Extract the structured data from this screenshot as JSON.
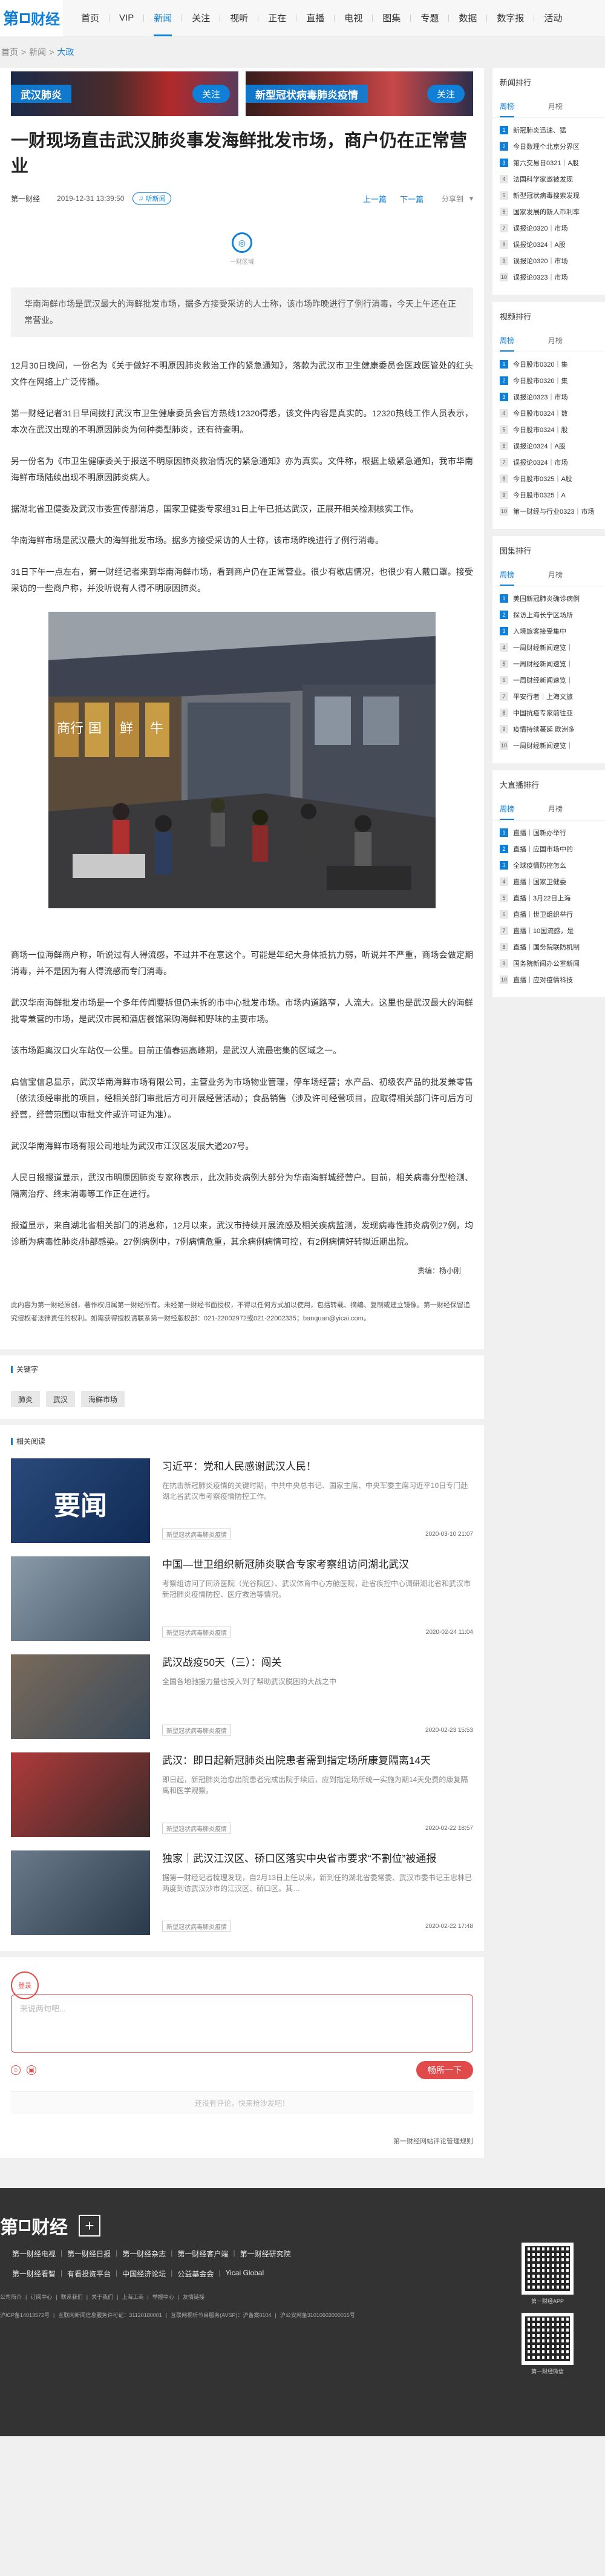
{
  "nav": {
    "logo_num": "第",
    "logo_txt": "财经",
    "links": [
      "首页",
      "VIP",
      "新闻",
      "关注",
      "视听",
      "正在",
      "直播",
      "电视",
      "图集",
      "专题",
      "数据",
      "数字报",
      "活动"
    ],
    "active_index": 2
  },
  "breadcrumb": {
    "home": "首页",
    "news": "新闻",
    "current": "大政",
    "sep": ">"
  },
  "topics": [
    {
      "name": "武汉肺炎",
      "follow": "关注"
    },
    {
      "name": "新型冠状病毒肺炎疫情",
      "follow": "关注"
    }
  ],
  "article": {
    "title": "一财现场直击武汉肺炎事发海鲜批发市场，商户仍在正常营业",
    "source": "第一财经",
    "date": "2019-12-31 13:39:50",
    "badge": "听新闻",
    "prev": "上一篇",
    "next": "下一篇",
    "share": "分享到",
    "author_logo": "一财",
    "author_name": "一财区域",
    "summary": "华南海鲜市场是武汉最大的海鲜批发市场，据多方接受采访的人士称，该市场昨晚进行了例行消毒，今天上午还在正常营业。",
    "paragraphs": [
      "12月30日晚间，一份名为《关于做好不明原因肺炎救治工作的紧急通知》，落款为武汉市卫生健康委员会医政医管处的红头文件在网络上广泛传播。",
      "第一财经记者31日早间拨打武汉市卫生健康委员会官方热线12320得悉，该文件内容是真实的。12320热线工作人员表示，本次在武汉出现的不明原因肺炎为何种类型肺炎，还有待查明。",
      "另一份名为《市卫生健康委关于报送不明原因肺炎救治情况的紧急通知》亦为真实。文件称，根据上级紧急通知，我市华南海鲜市场陆续出现不明原因肺炎病人。",
      "据湖北省卫健委及武汉市委宣传部消息，国家卫健委专家组31日上午已抵达武汉，正展开相关检测核实工作。",
      "华南海鲜市场是武汉最大的海鲜批发市场。据多方接受采访的人士称，该市场昨晚进行了例行消毒。",
      "31日下午一点左右，第一财经记者来到华南海鲜市场，看到商户仍在正常营业。很少有歇店情况，也很少有人戴口罩。接受采访的一些商户称，并没听说有人得不明原因肺炎。"
    ],
    "paragraphs2": [
      "商场一位海鲜商户称，听说过有人得流感，不过并不在意这个。可能是年纪大身体抵抗力弱，听说并不严重，商场会做定期消毒，并不是因为有人得流感而专门消毒。",
      "武汉华南海鲜批发市场是一个多年传闻要拆但仍未拆的市中心批发市场。市场内道路窄，人流大。这里也是武汉最大的海鲜批零兼营的市场，是武汉市民和酒店餐馆采购海鲜和野味的主要市场。",
      "该市场距离汉口火车站仅一公里。目前正值春运高峰期，是武汉人流最密集的区域之一。",
      "启信宝信息显示，武汉华南海鲜市场有限公司，主营业务为市场物业管理，停车场经营；水产品、初级农产品的批发兼零售（依法须经审批的项目，经相关部门审批后方可开展经营活动）；食品销售（涉及许可经营项目，应取得相关部门许可后方可经营，经营范围以审批文件或许可证为准）。",
      "武汉华南海鲜市场有限公司地址为武汉市江汉区发展大道207号。",
      "人民日报报道显示，武汉市明原因肺炎专家称表示，此次肺炎病例大部分为华南海鲜城经营户。目前，相关病毒分型检测、隔离治疗、终末消毒等工作正在进行。",
      "报道显示，来自湖北省相关部门的消息称，12月以来，武汉市持续开展流感及相关疾病监测，发现病毒性肺炎病例27例，均诊断为病毒性肺炎/肺部感染。27例病例中，7例病情危重，其余病例病情可控，有2例病情好转拟近期出院。"
    ],
    "signature": "责编：杨小刚",
    "copyright": "此内容为第一财经原创，著作权归属第一财经所有。未经第一财经书面授权，不得以任何方式加以使用，包括转载、摘编、复制或建立镜像。第一财经保留追究侵权者法律责任的权利。如需获得授权请联系第一财经版权部：021-22002972或021-22002335；banquan@yicai.com。",
    "copyright_email": "banquan@yicai.com"
  },
  "keywords": {
    "title": "关键字",
    "tags": [
      "肺炎",
      "武汉",
      "海鲜市场"
    ]
  },
  "related": {
    "title": "相关阅读",
    "items": [
      {
        "title": "习近平：党和人民感谢武汉人民！",
        "desc": "在抗击新冠肺炎疫情的关键时期，中共中央总书记、国家主席、中央军委主席习近平10日专门赴湖北省武汉市考察疫情防控工作。",
        "tag": "新型冠状病毒肺炎疫情",
        "date": "2020-03-10 21:07",
        "thumb_text": "要闻"
      },
      {
        "title": "中国—世卫组织新冠肺炎联合专家考察组访问湖北武汉",
        "desc": "考察组访问了同济医院（光谷院区）、武汉体育中心方舱医院，赴省疾控中心调研湖北省和武汉市新冠肺炎疫情防控、医疗救治等情况。",
        "tag": "新型冠状病毒肺炎疫情",
        "date": "2020-02-24 11:04",
        "thumb_text": ""
      },
      {
        "title": "武汉战疫50天（三）：闯关",
        "desc": "全国各地驰援力量也投入到了帮助武汉脱困的大战之中",
        "tag": "新型冠状病毒肺炎疫情",
        "date": "2020-02-23 15:53",
        "thumb_text": ""
      },
      {
        "title": "武汉：即日起新冠肺炎出院患者需到指定场所康复隔离14天",
        "desc": "即日起，新冠肺炎治愈出院患者完成出院手续后，应到指定场所统一实施为期14天免费的康复隔离和医学观察。",
        "tag": "新型冠状病毒肺炎疫情",
        "date": "2020-02-22 18:57",
        "thumb_text": ""
      },
      {
        "title": "独家｜武汉江汉区、硚口区落实中央省市要求“不割位”被通报",
        "desc": "据第一财经记者梳理发现，自2月13日上任以来，新到任的湖北省委常委、武汉市委书记王忠林已两度到访武汉沙市的江汉区、硚口区。其…",
        "tag": "新型冠状病毒肺炎疫情",
        "date": "2020-02-22 17:48",
        "thumb_text": ""
      }
    ]
  },
  "comment": {
    "login": "登录",
    "placeholder": "来说两句吧...",
    "send": "畅所一下",
    "empty": "还没有评论，快来抢沙发吧！",
    "policy": "第一财经网站评论管理规则"
  },
  "sidebar": {
    "boxes": [
      {
        "title": "新闻排行",
        "tabs": [
          "周榜",
          "月榜"
        ],
        "items": [
          "新冠肺炎迅速、猛",
          "今日数理个北京分界区",
          "第六交易日0321｜A股",
          "法国科学家邀被发现",
          "新型冠状病毒搜索发现",
          "国家发展的新人币利率",
          "误报论0320｜市场",
          "误报论0324｜A股",
          "误报论0320｜市场",
          "误报论0323｜市场"
        ]
      },
      {
        "title": "视频排行",
        "tabs": [
          "周榜",
          "月榜"
        ],
        "items": [
          "今日股市0320｜集",
          "今日股市0320｜集",
          "误报论0323｜市场",
          "今日股市0324｜数",
          "今日股市0324｜股",
          "误报论0324｜A股",
          "误报论0324｜市场",
          "今日股市0325｜A股",
          "今日股市0325｜A",
          "第一财经与行业0323｜市场"
        ]
      },
      {
        "title": "图集排行",
        "tabs": [
          "周榜",
          "月榜"
        ],
        "items": [
          "美国新冠肺炎确诊病例",
          "探访上海长宁区场所",
          "入境旅客接受集中",
          "一周财经新闻速览｜",
          "一周财经新闻速览｜",
          "一周财经新闻速览｜",
          "平安行者｜上海文旅",
          "中国抗疫专家前往亚",
          "疫情持续蔓延 欧洲多",
          "一周财经新闻速览｜"
        ]
      },
      {
        "title": "大直播排行",
        "tabs": [
          "周榜",
          "月榜"
        ],
        "items": [
          "直播｜国新办举行",
          "直播｜应国市场中的",
          "全球疫情防控怎么",
          "直播｜国家卫健委",
          "直播｜3月22日上海",
          "直播｜世卫组织举行",
          "直播｜10国流感，是",
          "直播｜国务院联防机制",
          "国务院新闻办公室新闻",
          "直播｜应对疫情科技"
        ]
      }
    ]
  },
  "footer": {
    "logo_num": "第",
    "logo_txt": "财经",
    "plus": "+",
    "links1": [
      "第一财经电视",
      "第一财经日报",
      "第一财经杂志",
      "第一财经客户端",
      "第一财经研究院"
    ],
    "links2": [
      "第一财经看智",
      "有看投资平台",
      "中国经济论坛",
      "公益基金会",
      "Yicai Global"
    ],
    "legal1": [
      "沪ICP备14013572号",
      "互联网新闻信息服务许可证：31120180001",
      "互联网视听节目服务(AVSP)：沪备案0104",
      "沪公安网备31010602000015号"
    ],
    "legal2": [
      "公司简介",
      "订阅中心",
      "联系我们",
      "关于我们",
      "上海工商",
      "举报中心",
      "友情链接"
    ],
    "qr1": "第一财经APP",
    "qr2": "第一财经微信"
  }
}
